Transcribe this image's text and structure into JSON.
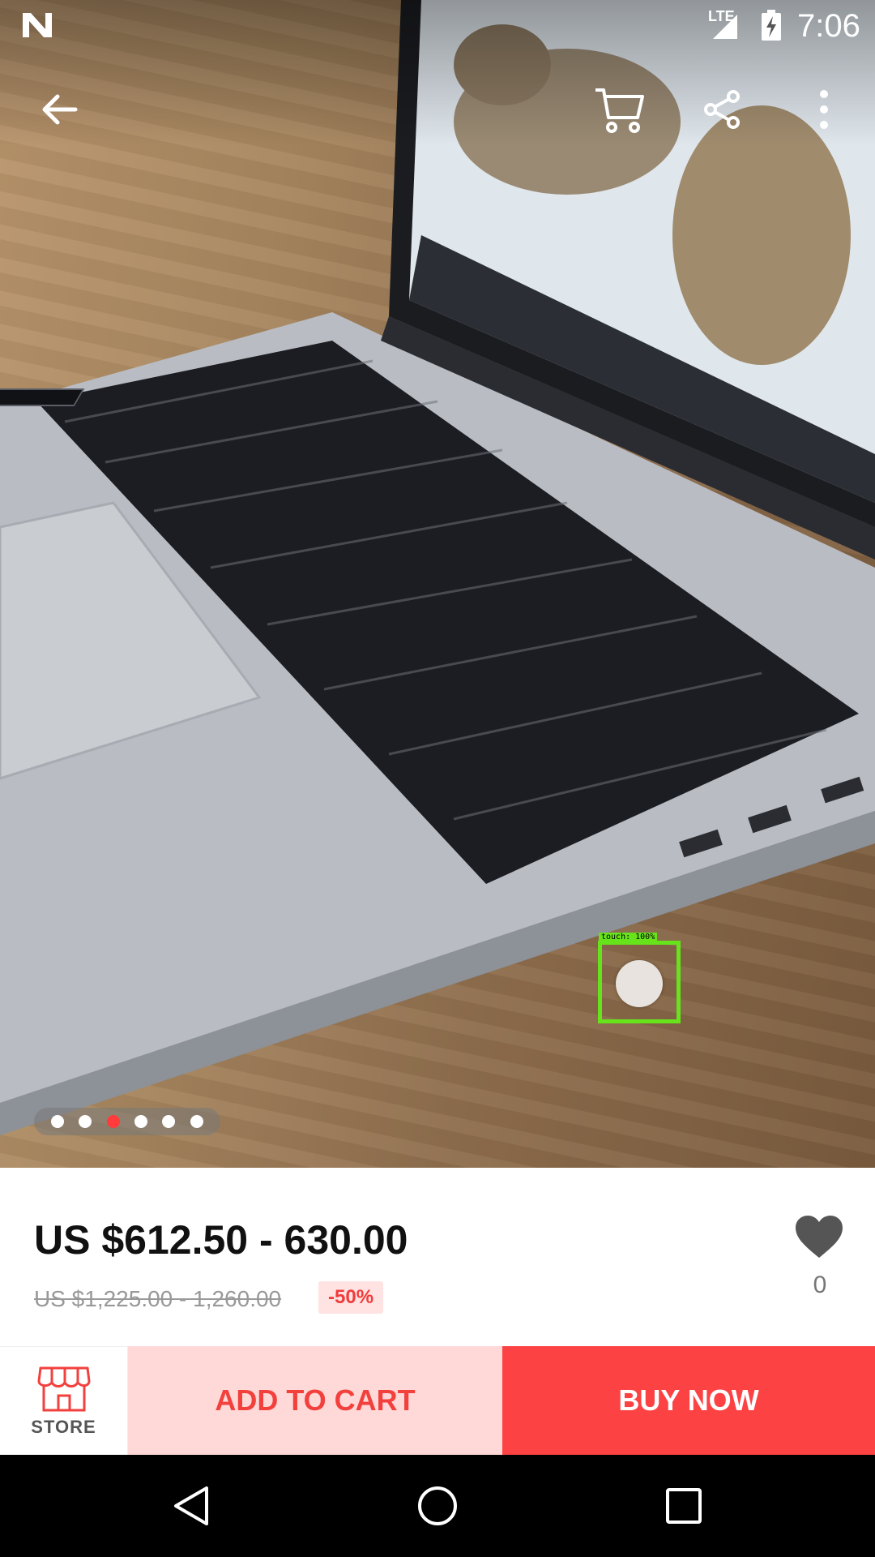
{
  "status_bar": {
    "network": "LTE",
    "time": "7:06"
  },
  "toolbar": {
    "back_icon": "arrow-left-icon",
    "cart_icon": "shopping-cart-icon",
    "share_icon": "share-icon",
    "more_icon": "more-vertical-icon"
  },
  "gallery": {
    "image_count": 6,
    "active_index": 3
  },
  "touch_overlay": {
    "label": "touch: 100%"
  },
  "product": {
    "price": "US $612.50 - 630.00",
    "original_price": "US $1,225.00 - 1,260.00",
    "discount": "-50%",
    "wishlist_count": "0"
  },
  "actions": {
    "store_label": "STORE",
    "add_to_cart_label": "ADD TO CART",
    "buy_now_label": "BUY NOW"
  },
  "colors": {
    "accent": "#fc4242",
    "accent_light": "#ffd8d8",
    "discount_text": "#f23b3b"
  }
}
